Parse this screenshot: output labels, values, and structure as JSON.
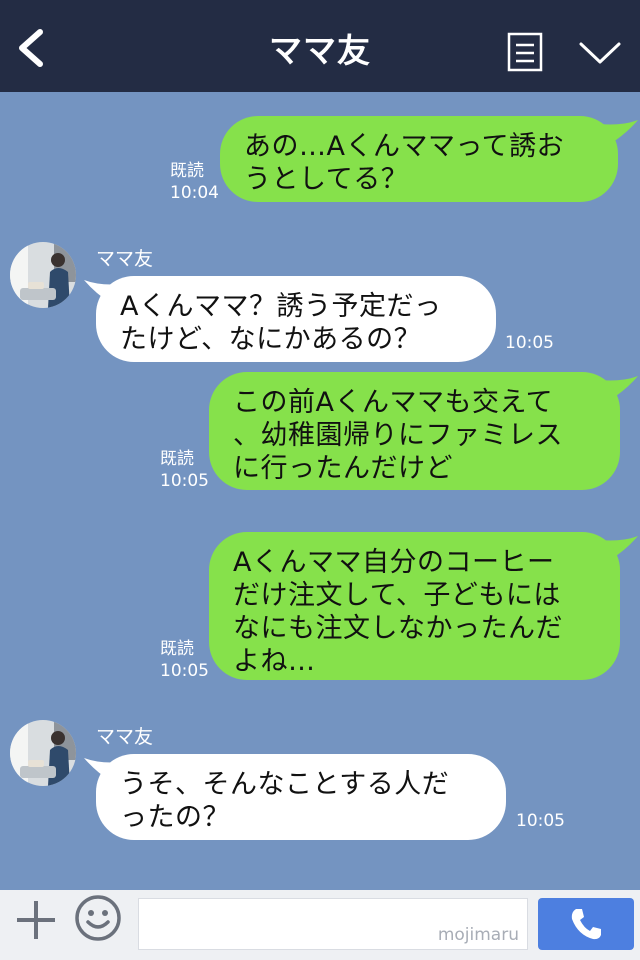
{
  "header": {
    "title": "ママ友",
    "back_icon": "back-chevron-icon",
    "menu_icon": "note-list-icon",
    "chevron_icon": "chevron-down-icon"
  },
  "messages": [
    {
      "side": "right",
      "text_lines": [
        "あの…Aくんママって誘お",
        "うとしてる？"
      ],
      "read": "既読",
      "time": "10:04"
    },
    {
      "side": "left",
      "sender": "ママ友",
      "text_lines": [
        "Aくんママ？誘う予定だっ",
        "たけど、なにかあるの？"
      ],
      "time": "10:05"
    },
    {
      "side": "right",
      "text_lines": [
        "この前Aくんママも交えて",
        "、幼稚園帰りにファミレス",
        "に行ったんだけど"
      ],
      "read": "既読",
      "time": "10:05"
    },
    {
      "side": "right",
      "text_lines": [
        "Aくんママ自分のコーヒー",
        "だけ注文して、子どもには",
        "なにも注文しなかったんだ",
        "よね…"
      ],
      "read": "既読",
      "time": "10:05"
    },
    {
      "side": "left",
      "sender": "ママ友",
      "text_lines": [
        "うそ、そんなことする人だ",
        "ったの？"
      ],
      "time": "10:05"
    }
  ],
  "footer": {
    "plus_icon": "plus-icon",
    "emoji_icon": "emoji-icon",
    "watermark": "mojimaru",
    "call_icon": "phone-icon"
  },
  "colors": {
    "background": "#7494c1",
    "header": "#232c44",
    "bubble_sent": "#86e14b",
    "bubble_received": "#ffffff",
    "call_button": "#4d7fe0"
  }
}
